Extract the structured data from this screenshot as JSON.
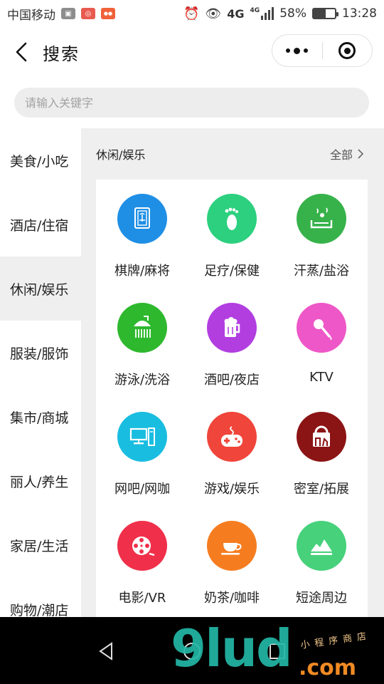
{
  "status_bar": {
    "carrier": "中国移动",
    "network_label": "4G",
    "network_label_2": "4G",
    "battery_percent": "58%",
    "battery_level": 0.58,
    "time": "13:28",
    "icons": [
      "photo-icon",
      "weibo-icon",
      "app-icon",
      "alarm-icon",
      "eye-icon",
      "signal-icon",
      "battery-icon"
    ]
  },
  "header": {
    "title": "搜索"
  },
  "search": {
    "placeholder": "请输入关键字"
  },
  "sidebar": {
    "items": [
      {
        "label": "美食/小吃",
        "active": false
      },
      {
        "label": "酒店/住宿",
        "active": false
      },
      {
        "label": "休闲/娱乐",
        "active": true
      },
      {
        "label": "服装/服饰",
        "active": false
      },
      {
        "label": "集市/商城",
        "active": false
      },
      {
        "label": "丽人/养生",
        "active": false
      },
      {
        "label": "家居/生活",
        "active": false
      },
      {
        "label": "购物/潮店",
        "active": false
      }
    ]
  },
  "content": {
    "category_title": "休闲/娱乐",
    "see_all": "全部",
    "items": [
      {
        "label": "棋牌/麻将",
        "icon": "mahjong-icon",
        "color": "#1f8fe6"
      },
      {
        "label": "足疗/保健",
        "icon": "foot-icon",
        "color": "#2cd07e"
      },
      {
        "label": "汗蒸/盐浴",
        "icon": "sauna-icon",
        "color": "#37b24a"
      },
      {
        "label": "游泳/洗浴",
        "icon": "shower-icon",
        "color": "#2eb82e"
      },
      {
        "label": "酒吧/夜店",
        "icon": "beer-icon",
        "color": "#b23ee0"
      },
      {
        "label": "KTV",
        "icon": "microphone-icon",
        "color": "#ee57c7"
      },
      {
        "label": "网吧/网咖",
        "icon": "computer-icon",
        "color": "#19bde0"
      },
      {
        "label": "游戏/娱乐",
        "icon": "gamepad-icon",
        "color": "#f0453a"
      },
      {
        "label": "密室/拓展",
        "icon": "escape-room-icon",
        "color": "#8b1414"
      },
      {
        "label": "电影/VR",
        "icon": "film-reel-icon",
        "color": "#f0304a"
      },
      {
        "label": "奶茶/咖啡",
        "icon": "coffee-cup-icon",
        "color": "#f57d20"
      },
      {
        "label": "短途周边",
        "icon": "mountain-icon",
        "color": "#46d17a"
      }
    ]
  },
  "watermark": {
    "brand": "9lud",
    "suffix": ".com",
    "subtitle": "小程序商店"
  }
}
